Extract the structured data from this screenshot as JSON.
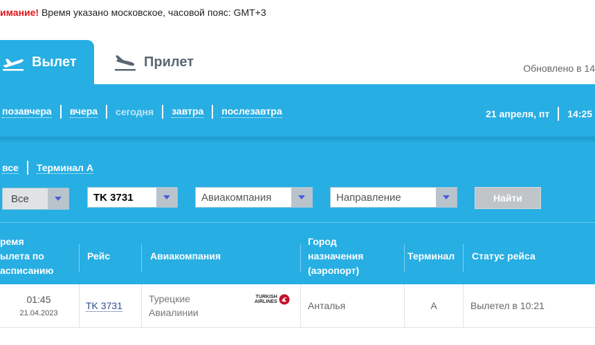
{
  "notice": {
    "warning": "имание!",
    "text": " Время указано московское, часовой пояс: GMT+3"
  },
  "tabs": {
    "departure": "Вылет",
    "arrival": "Прилет"
  },
  "updated": "Обновлено в 14",
  "days": [
    "позавчера",
    "вчера",
    "сегодня",
    "завтра",
    "послезавтра"
  ],
  "current_day_index": 2,
  "date": {
    "label": "21 апреля, пт",
    "time": "14:25"
  },
  "terminals": [
    "все",
    "Терминал А"
  ],
  "filters": {
    "terminal_select": "Все",
    "flight_select": "TK 3731",
    "airline_select": "Авиакомпания",
    "direction_select": "Направление",
    "find_label": "Найти"
  },
  "columns": {
    "time": [
      "ремя",
      "ылета по",
      "асписанию"
    ],
    "flight": "Рейс",
    "airline": "Авиакомпания",
    "destination": [
      "Город",
      "назначения",
      "(аэропорт)"
    ],
    "terminal": "Терминал",
    "status": "Статус рейса"
  },
  "rows": [
    {
      "time": "01:45",
      "date": "21.04.2023",
      "flight": "TK 3731",
      "airline": [
        "Турецкие",
        "Авиалинии"
      ],
      "logo_text": [
        "TURKISH",
        "AIRLINES"
      ],
      "destination": "Анталья",
      "terminal": "A",
      "status": "Вылетел в 10:21"
    }
  ],
  "colors": {
    "accent": "#27aee3",
    "warning": "#e3141b",
    "logo_red": "#c8102e"
  }
}
